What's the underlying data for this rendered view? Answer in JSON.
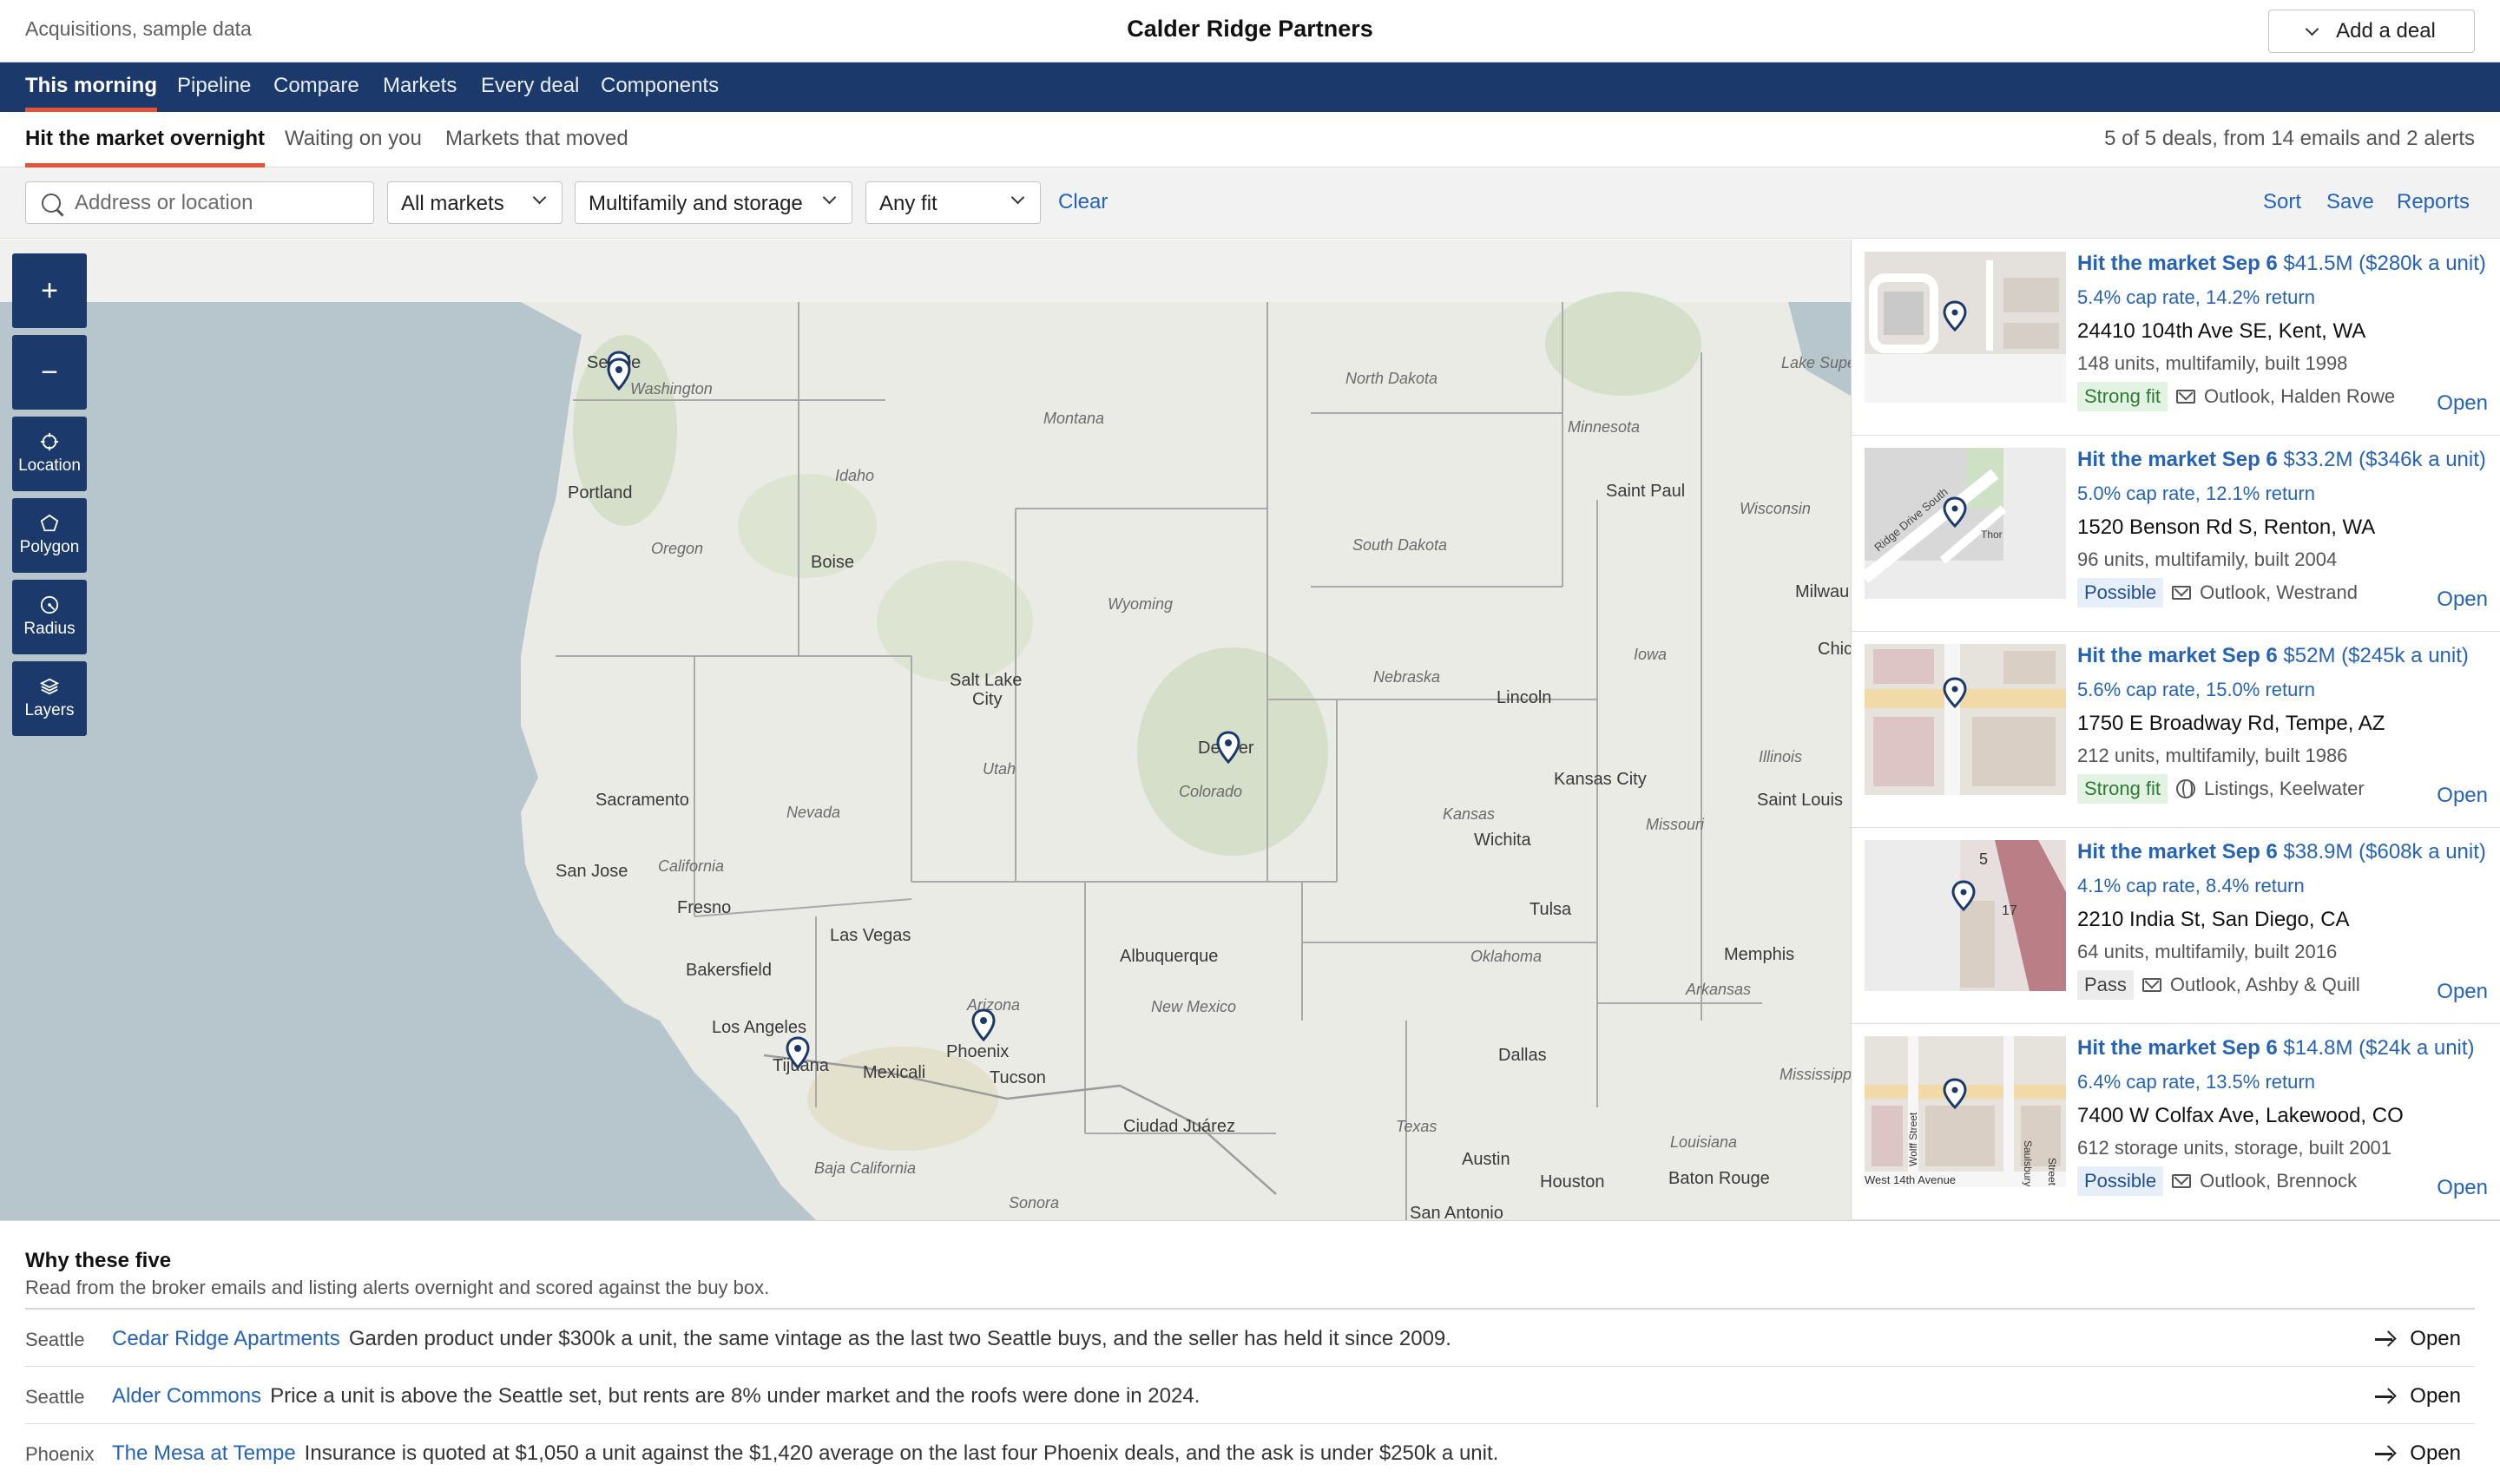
{
  "header": {
    "subtitle": "Acquisitions, sample data",
    "title": "Calder Ridge Partners",
    "add_deal_label": "Add a deal"
  },
  "nav": {
    "items": [
      {
        "label": "This morning",
        "active": true
      },
      {
        "label": "Pipeline"
      },
      {
        "label": "Compare"
      },
      {
        "label": "Markets"
      },
      {
        "label": "Every deal"
      },
      {
        "label": "Components"
      }
    ]
  },
  "subtabs": {
    "items": [
      {
        "label": "Hit the market overnight",
        "active": true
      },
      {
        "label": "Waiting on you"
      },
      {
        "label": "Markets that moved"
      }
    ],
    "summary": "5 of 5 deals, from 14 emails and 2 alerts"
  },
  "filters": {
    "search_placeholder": "Address or location",
    "market": "All markets",
    "product": "Multifamily and storage",
    "fit": "Any fit",
    "clear_label": "Clear",
    "sort_label": "Sort",
    "save_label": "Save",
    "reports_label": "Reports"
  },
  "map_tools": {
    "zoom_in": "+",
    "zoom_out": "−",
    "location": "Location",
    "polygon": "Polygon",
    "radius": "Radius",
    "layers": "Layers"
  },
  "map_labels": {
    "seattle": "Seattle",
    "washington": "Washington",
    "portland": "Portland",
    "oregon": "Oregon",
    "idaho": "Idaho",
    "boise": "Boise",
    "montana": "Montana",
    "wyoming": "Wyoming",
    "north_dakota": "North Dakota",
    "south_dakota": "South Dakota",
    "minnesota": "Minnesota",
    "saint_paul": "Saint Paul",
    "wisconsin": "Wisconsin",
    "milwaukee": "Milwau",
    "lake_superior": "Lake Supe",
    "iowa": "Iowa",
    "chicago": "Chic",
    "nebraska": "Nebraska",
    "lincoln": "Lincoln",
    "salt_lake": "Salt Lake",
    "salt_lake_2": "City",
    "utah": "Utah",
    "denver": "Denver",
    "colorado": "Colorado",
    "kansas": "Kansas",
    "kansas_city": "Kansas City",
    "wichita": "Wichita",
    "missouri": "Missouri",
    "illinois": "Illinois",
    "saint_louis": "Saint Louis",
    "sacramento": "Sacramento",
    "nevada": "Nevada",
    "san_jose": "San Jose",
    "california": "California",
    "fresno": "Fresno",
    "las_vegas": "Las Vegas",
    "bakersfield": "Bakersfield",
    "los_angeles": "Los Angeles",
    "tijuana": "Tijuana",
    "mexicali": "Mexicali",
    "arizona": "Arizona",
    "phoenix": "Phoenix",
    "tucson": "Tucson",
    "albuquerque": "Albuquerque",
    "new_mexico": "New Mexico",
    "ciudad_juarez": "Ciudad Juárez",
    "tulsa": "Tulsa",
    "oklahoma": "Oklahoma",
    "memphis": "Memphis",
    "arkansas": "Arkansas",
    "dallas": "Dallas",
    "texas": "Texas",
    "austin": "Austin",
    "houston": "Houston",
    "louisiana": "Louisiana",
    "baton_rouge": "Baton Rouge",
    "mississippi": "Mississippi",
    "baja": "Baja California",
    "sonora": "Sonora",
    "san_antonio": "San Antonio"
  },
  "deals": [
    {
      "status": "Hit the market Sep 6",
      "price": "$41.5M ($280k a unit)",
      "rate": "5.4% cap rate, 14.2% return",
      "address": "24410 104th Ave SE, Kent, WA",
      "meta": "148 units, multifamily, built 1998",
      "fit": "Strong fit",
      "fit_kind": "strong",
      "source_icon": "mail",
      "source": "Outlook, Halden Rowe",
      "open": "Open"
    },
    {
      "status": "Hit the market Sep 6",
      "price": "$33.2M ($346k a unit)",
      "rate": "5.0% cap rate, 12.1% return",
      "address": "1520 Benson Rd S, Renton, WA",
      "meta": "96 units, multifamily, built 2004",
      "fit": "Possible",
      "fit_kind": "possible",
      "source_icon": "mail",
      "source": "Outlook, Westrand",
      "open": "Open",
      "thumb_street_a": "Ridge Drive South",
      "thumb_street_b": "Thor"
    },
    {
      "status": "Hit the market Sep 6",
      "price": "$52M ($245k a unit)",
      "rate": "5.6% cap rate, 15.0% return",
      "address": "1750 E Broadway Rd, Tempe, AZ",
      "meta": "212 units, multifamily, built 1986",
      "fit": "Strong fit",
      "fit_kind": "strong",
      "source_icon": "globe",
      "source": "Listings, Keelwater",
      "open": "Open"
    },
    {
      "status": "Hit the market Sep 6",
      "price": "$38.9M ($608k a unit)",
      "rate": "4.1% cap rate, 8.4% return",
      "address": "2210 India St, San Diego, CA",
      "meta": "64 units, multifamily, built 2016",
      "fit": "Pass",
      "fit_kind": "pass",
      "source_icon": "mail",
      "source": "Outlook, Ashby & Quill",
      "open": "Open",
      "thumb_street_a": "5",
      "thumb_street_b": "17"
    },
    {
      "status": "Hit the market Sep 6",
      "price": "$14.8M ($24k a unit)",
      "rate": "6.4% cap rate, 13.5% return",
      "address": "7400 W Colfax Ave, Lakewood, CO",
      "meta": "612 storage units, storage, built 2001",
      "fit": "Possible",
      "fit_kind": "possible",
      "source_icon": "mail",
      "source": "Outlook, Brennock",
      "open": "Open",
      "thumb_street_a": "Wolff Street",
      "thumb_street_b": "Saulsbury",
      "thumb_street_c": "Street",
      "thumb_street_d": "West 14th Avenue"
    }
  ],
  "why": {
    "title": "Why these five",
    "desc": "Read from the broker emails and listing alerts overnight and scored against the buy box.",
    "rows": [
      {
        "city": "Seattle",
        "name": "Cedar Ridge Apartments",
        "text": "Garden product under $300k a unit, the same vintage as the last two Seattle buys, and the seller has held it since 2009.",
        "open": "Open"
      },
      {
        "city": "Seattle",
        "name": "Alder Commons",
        "text": "Price a unit is above the Seattle set, but rents are 8% under market and the roofs were done in 2024.",
        "open": "Open"
      },
      {
        "city": "Phoenix",
        "name": "The Mesa at Tempe",
        "text": "Insurance is quoted at $1,050 a unit against the $1,420 average on the last four Phoenix deals, and the ask is under $250k a unit.",
        "open": "Open"
      }
    ]
  }
}
